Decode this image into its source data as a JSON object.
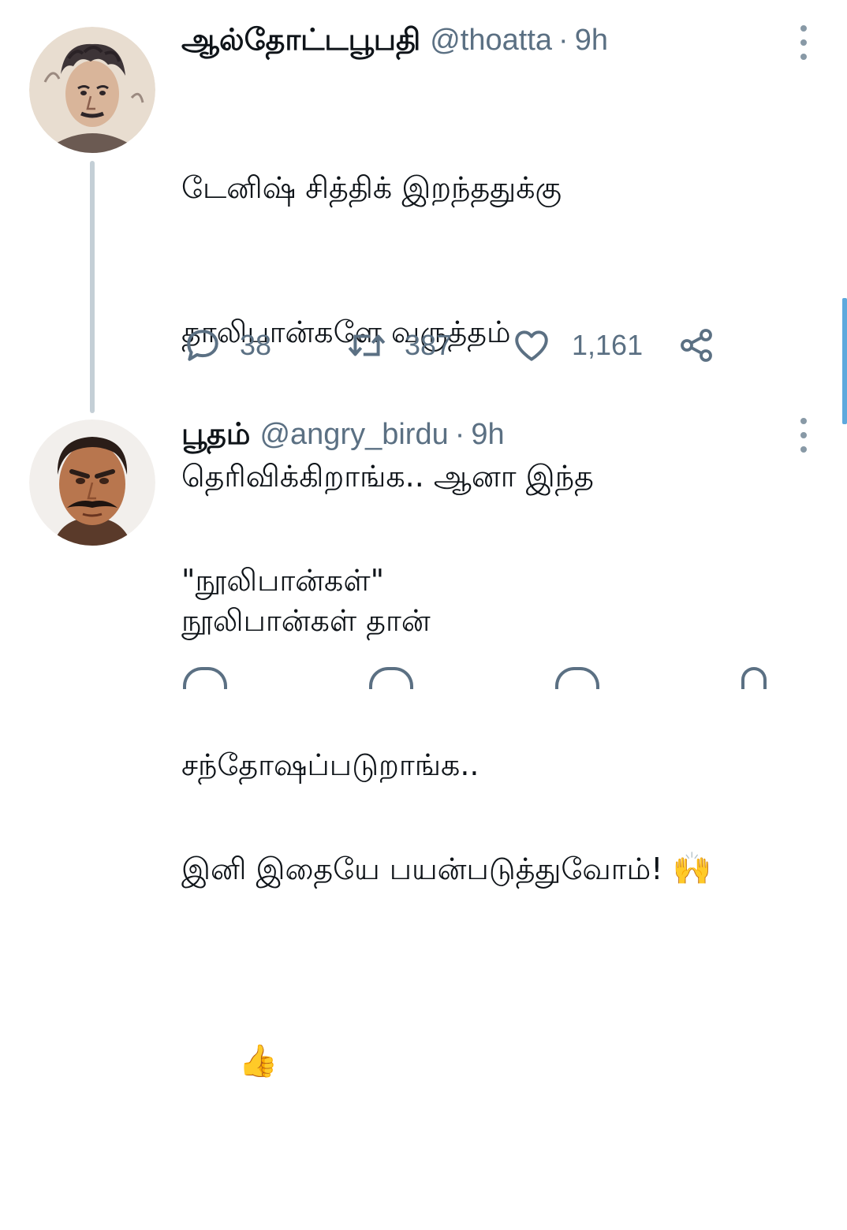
{
  "tweets": [
    {
      "name": "ஆல்தோட்டபூபதி",
      "handle": "@thoatta",
      "separator": "·",
      "time": "9h",
      "lines": [
        "டேனிஷ் சித்திக் இறந்ததுக்கு",
        "தாலிபான்களே வருத்தம்",
        "தெரிவிக்கிறாங்க.. ஆனா இந்த",
        "நூலிபான்கள் தான்",
        "சந்தோஷப்படுறாங்க.."
      ],
      "actions": {
        "reply_count": "38",
        "retweet_count": "387",
        "like_count": "1,161"
      },
      "avatar_icon": "avatar-sketch-portrait"
    },
    {
      "name": "பூதம்",
      "handle": "@angry_birdu",
      "separator": "·",
      "time": "9h",
      "line1": "\"நூலிபான்கள்\"",
      "line2": "இனி இதையே பயன்படுத்துவோம்!",
      "emoji_raised_hands": "🙌",
      "emoji_thumbs_up": "👍",
      "avatar_icon": "avatar-mustache-man"
    }
  ],
  "colors": {
    "text": "#0f1419",
    "secondary": "#5b7083",
    "thread_line": "#c4cfd6",
    "scrollbar": "#5ea9dd",
    "more_dots": "#8899a6"
  }
}
